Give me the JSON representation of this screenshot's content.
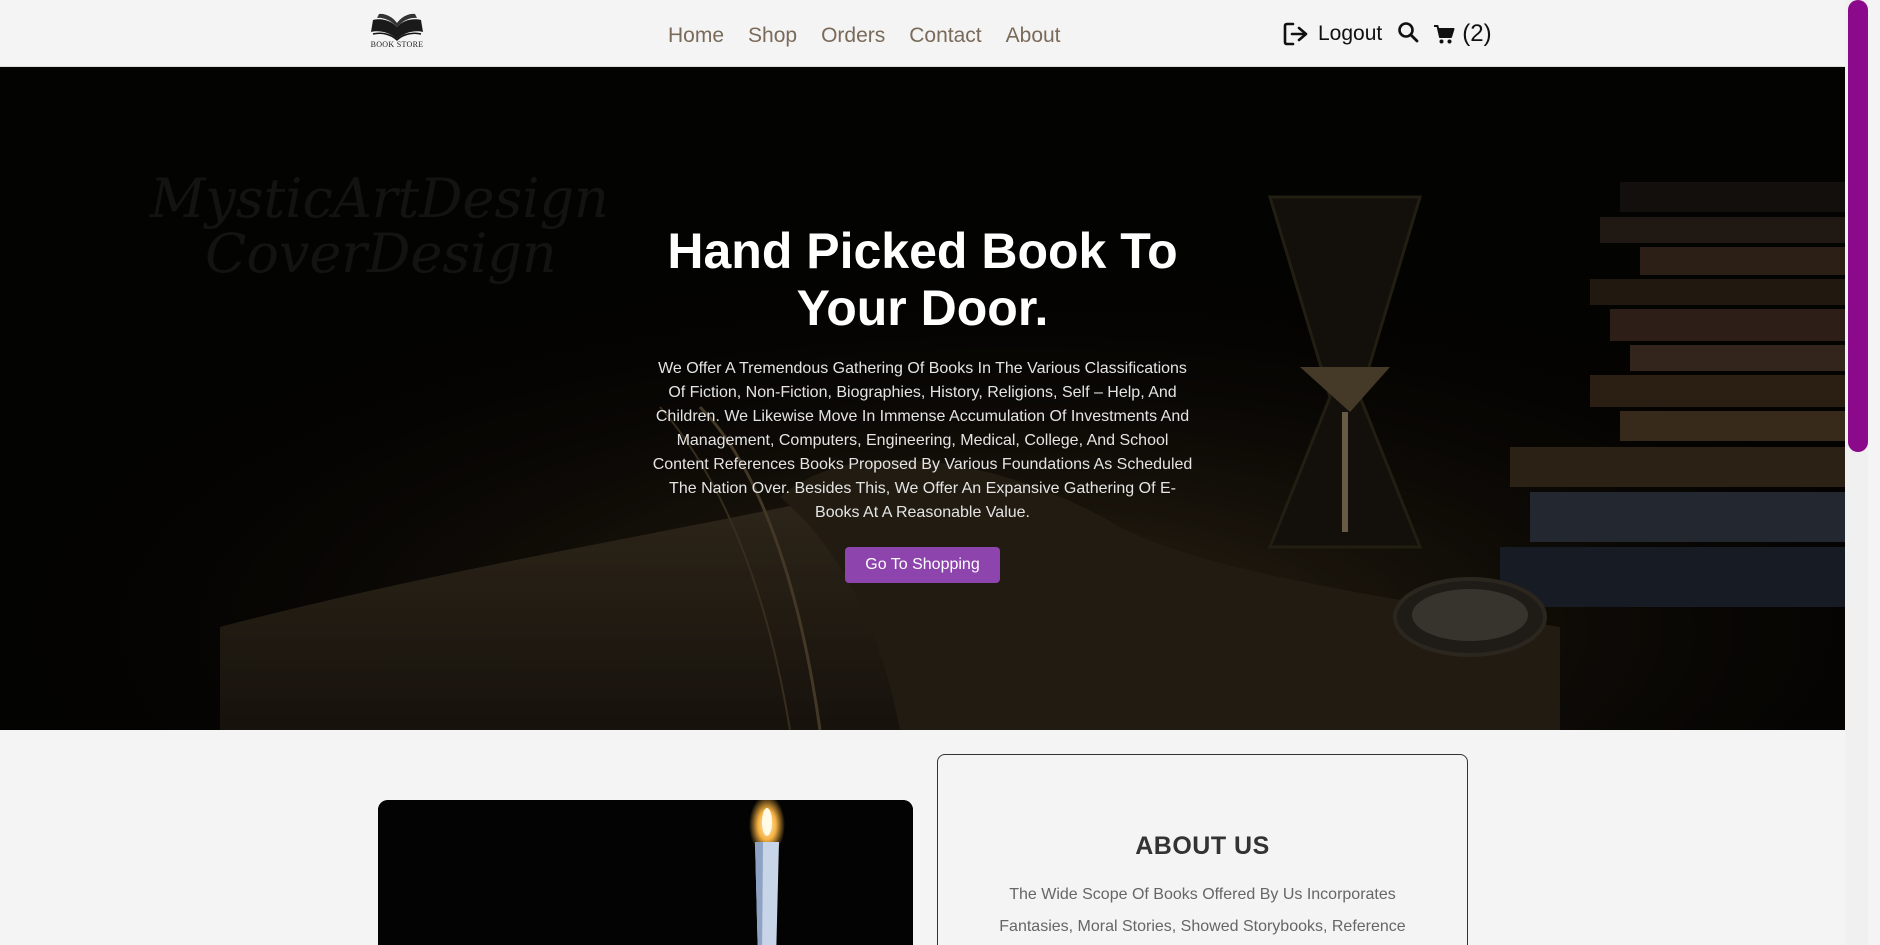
{
  "header": {
    "logo_text": "BOOK STORE",
    "nav": [
      "Home",
      "Shop",
      "Orders",
      "Contact",
      "About"
    ],
    "logout_label": "Logout",
    "cart_count": "(2)"
  },
  "hero": {
    "watermark": [
      "MysticArtDesign",
      "CoverDesign"
    ],
    "title": "Hand Picked Book To Your Door.",
    "description": "We Offer A Tremendous Gathering Of Books In The Various Classifications Of Fiction, Non-Fiction, Biographies, History, Religions, Self – Help, And Children. We Likewise Move In Immense Accumulation Of Investments And Management, Computers, Engineering, Medical, College, And School Content References Books Proposed By Various Foundations As Scheduled The Nation Over. Besides This, We Offer An Expansive Gathering Of E-Books At A Reasonable Value.",
    "button_label": "Go To Shopping"
  },
  "about": {
    "title": "ABOUT US",
    "text": "The Wide Scope Of Books Offered By Us Incorporates Fantasies, Moral Stories, Showed Storybooks, Reference"
  },
  "colors": {
    "accent": "#8e44ad",
    "scrollbar": "#8b0a8b",
    "nav_text": "#7a6a5a"
  },
  "icons": [
    "logout-icon",
    "search-icon",
    "cart-icon",
    "book-logo-icon"
  ]
}
